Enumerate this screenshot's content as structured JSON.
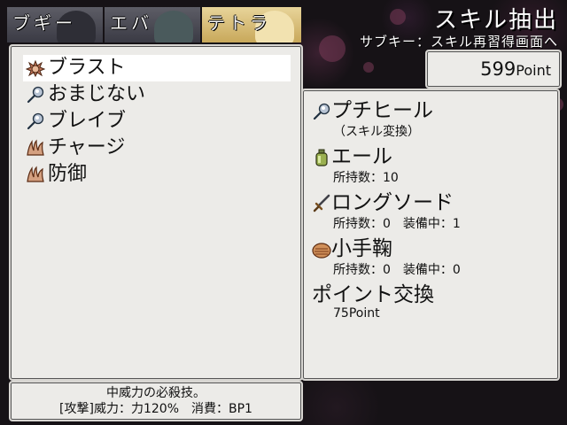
{
  "tabs": [
    {
      "label": "ブギー",
      "active": false
    },
    {
      "label": "エバ",
      "active": false
    },
    {
      "label": "テトラ",
      "active": true
    }
  ],
  "header": {
    "title": "スキル抽出",
    "subtitle": "サブキー：スキル再習得画面へ"
  },
  "points": {
    "value": "599",
    "unit": "Point"
  },
  "skills": [
    {
      "label": "ブラスト",
      "icon": "spiked-shell-icon",
      "selected": true
    },
    {
      "label": "おまじない",
      "icon": "magic-orb-icon",
      "selected": false
    },
    {
      "label": "ブレイブ",
      "icon": "magic-orb-icon",
      "selected": false
    },
    {
      "label": "チャージ",
      "icon": "claw-icon",
      "selected": false
    },
    {
      "label": "防御",
      "icon": "claw-icon",
      "selected": false
    }
  ],
  "items": [
    {
      "name": "プチヒール",
      "sub": "（スキル変換）",
      "icon": "magic-orb-icon"
    },
    {
      "name": "エール",
      "sub": "所持数：10",
      "icon": "potion-bottle-icon"
    },
    {
      "name": "ロングソード",
      "sub": "所持数：0　装備中：1",
      "icon": "sword-icon"
    },
    {
      "name": "小手鞠",
      "sub": "所持数：0　装備中：0",
      "icon": "shell-icon"
    },
    {
      "name": "ポイント交換",
      "sub": "75Point",
      "icon": ""
    }
  ],
  "description": {
    "line1": "中威力の必殺技。",
    "line2": "[攻撃]威力：力120%　消費：BP1"
  },
  "colors": {
    "accent_tab": "#d8bc74",
    "panel": "#ecebe8"
  }
}
